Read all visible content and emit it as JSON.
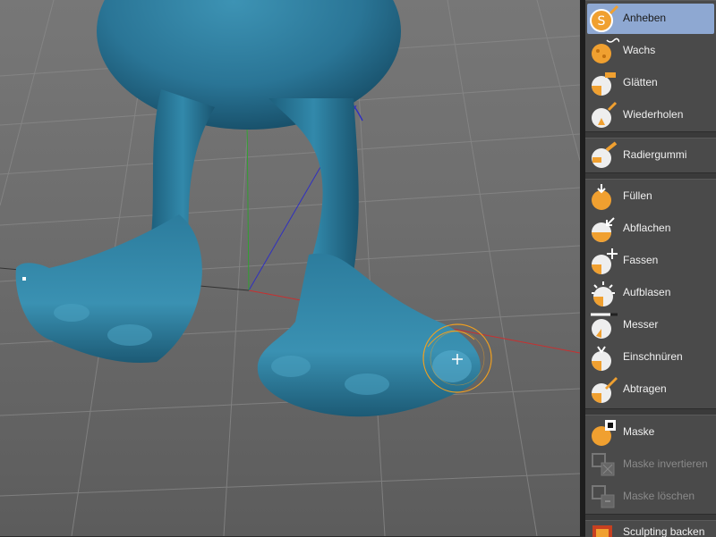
{
  "tools": {
    "anheben": "Anheben",
    "wachs": "Wachs",
    "glaetten": "Glätten",
    "wiederholen": "Wiederholen",
    "radiergummi": "Radiergummi",
    "fuellen": "Füllen",
    "abflachen": "Abflachen",
    "fassen": "Fassen",
    "aufblasen": "Aufblasen",
    "messer": "Messer",
    "einschnueren": "Einschnüren",
    "abtragen": "Abtragen",
    "maske": "Maske",
    "maske_invertieren": "Maske invertieren",
    "maske_loeschen": "Maske löschen",
    "sculpting_backen": "Sculpting backen"
  },
  "active_tool": "Anheben",
  "colors": {
    "model": "#2f7f9e",
    "brush_ring": "#f0a020",
    "icon_orange": "#f0a030",
    "active_highlight": "#8ea8d2"
  }
}
